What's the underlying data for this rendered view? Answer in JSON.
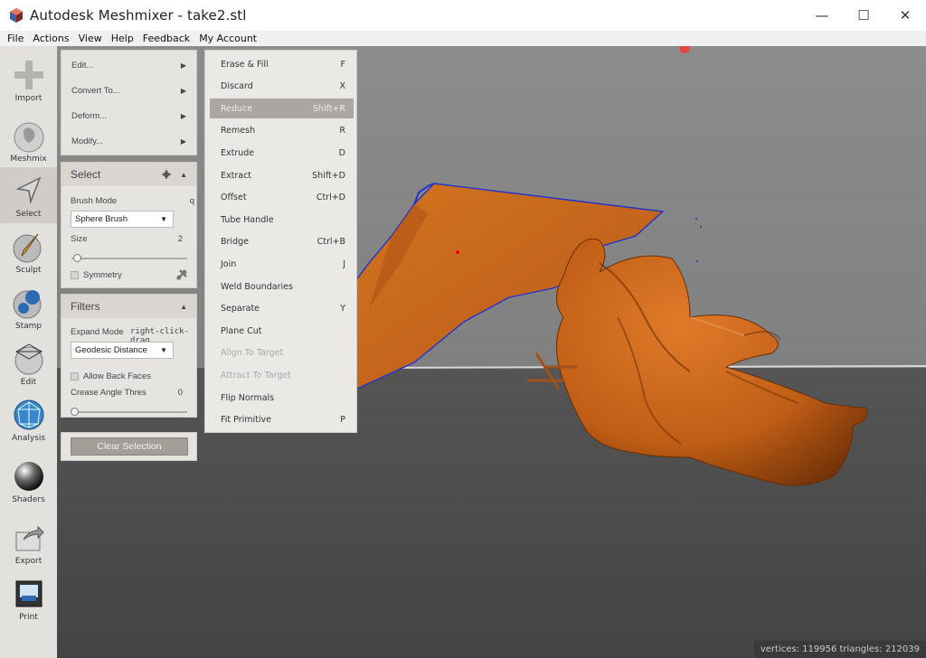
{
  "window": {
    "title": "Autodesk Meshmixer - take2.stl",
    "controls": {
      "minimize": "—",
      "maximize": "☐",
      "close": "✕"
    }
  },
  "menubar": [
    "File",
    "Actions",
    "View",
    "Help",
    "Feedback",
    "My Account"
  ],
  "toolbar": [
    {
      "label": "Import",
      "icon": "plus-icon"
    },
    {
      "label": "Meshmix",
      "icon": "bunny-icon"
    },
    {
      "label": "Select",
      "icon": "arrow-icon",
      "active": true
    },
    {
      "label": "Sculpt",
      "icon": "brush-icon"
    },
    {
      "label": "Stamp",
      "icon": "stamp-icon"
    },
    {
      "label": "Edit",
      "icon": "edit-icon"
    },
    {
      "label": "Analysis",
      "icon": "analysis-icon"
    },
    {
      "label": "Shaders",
      "icon": "sphere-icon"
    },
    {
      "label": "Export",
      "icon": "export-icon"
    },
    {
      "label": "Print",
      "icon": "printer-icon"
    }
  ],
  "actions_panel": {
    "items": [
      {
        "label": "Edit...",
        "arrow": "▶"
      },
      {
        "label": "Convert To...",
        "arrow": "▶"
      },
      {
        "label": "Deform...",
        "arrow": "▶"
      },
      {
        "label": "Modify...",
        "arrow": "▶"
      }
    ]
  },
  "select_panel": {
    "title": "Select",
    "collapse": "▲",
    "brush_mode_label": "Brush Mode",
    "brush_mode_hotkey": "q",
    "brush_value": "Sphere Brush",
    "size_label": "Size",
    "size_value": "2",
    "size_fraction": 0.02,
    "symmetry_label": "Symmetry"
  },
  "filters_panel": {
    "title": "Filters",
    "collapse": "▲",
    "expand_mode_label": "Expand Mode",
    "expand_mode_value": "right-click-drag",
    "geodesic_value": "Geodesic Distance",
    "allow_back_faces_label": "Allow Back Faces",
    "crease_label": "Crease Angle Thres",
    "crease_value": "0",
    "crease_fraction": 0.0
  },
  "clear_selection_label": "Clear Selection",
  "dropdown_arrow": "▼",
  "edit_submenu": [
    {
      "label": "Erase & Fill",
      "shortcut": "F"
    },
    {
      "label": "Discard",
      "shortcut": "X"
    },
    {
      "label": "Reduce",
      "shortcut": "Shift+R",
      "highlighted": true
    },
    {
      "label": "Remesh",
      "shortcut": "R"
    },
    {
      "label": "Extrude",
      "shortcut": "D"
    },
    {
      "label": "Extract",
      "shortcut": "Shift+D"
    },
    {
      "label": "Offset",
      "shortcut": "Ctrl+D"
    },
    {
      "label": "Tube Handle",
      "shortcut": ""
    },
    {
      "label": "Bridge",
      "shortcut": "Ctrl+B"
    },
    {
      "label": "Join",
      "shortcut": "J"
    },
    {
      "label": "Weld Boundaries",
      "shortcut": ""
    },
    {
      "label": "Separate",
      "shortcut": "Y"
    },
    {
      "label": "Plane Cut",
      "shortcut": ""
    },
    {
      "label": "Align To Target",
      "shortcut": "",
      "disabled": true
    },
    {
      "label": "Attract To Target",
      "shortcut": "",
      "disabled": true
    },
    {
      "label": "Flip Normals",
      "shortcut": ""
    },
    {
      "label": "Fit Primitive",
      "shortcut": "P"
    }
  ],
  "status_text": "vertices: 119956  triangles: 212039",
  "colors": {
    "viewport_top": "#8b8b8b",
    "viewport_floor": "#4a4a4a",
    "mesh": "#c8651a",
    "mesh_dark": "#7a3608",
    "boundary": "#2233cc",
    "selection_highlight": "#aaa6a1"
  }
}
